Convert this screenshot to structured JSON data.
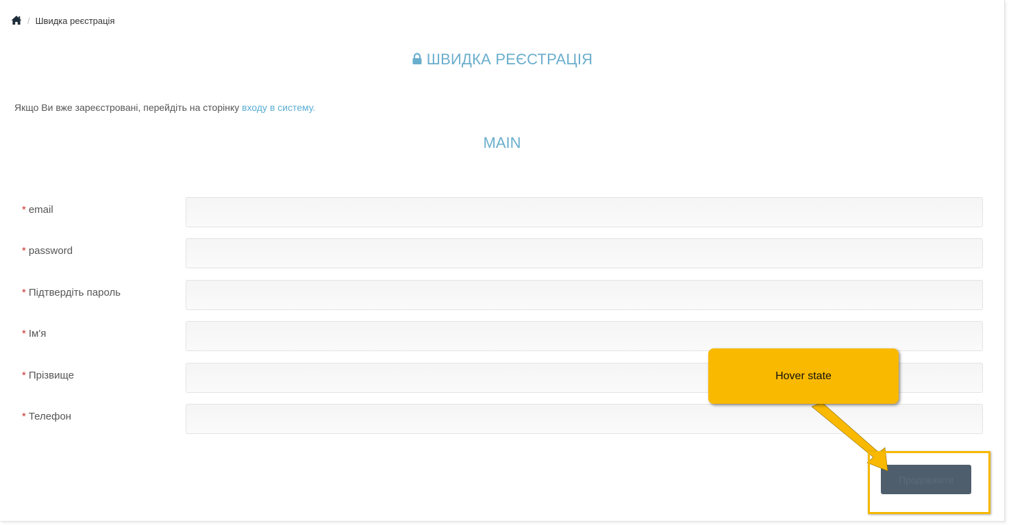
{
  "breadcrumb": {
    "home_icon": "home-icon",
    "current": "Швидка реєстрація"
  },
  "page": {
    "title": "ШВИДКА РЕЄСТРАЦІЯ",
    "title_icon": "lock-icon",
    "info_text": "Якщо Ви вже зареєстровані, перейдіть на сторінку ",
    "login_link": "входу в систему.",
    "section_title": "MAIN"
  },
  "form": {
    "required_mark": "*",
    "fields": [
      {
        "label": "email",
        "value": "",
        "placeholder": ""
      },
      {
        "label": "password",
        "value": "",
        "placeholder": ""
      },
      {
        "label": "Підтвердіть пароль",
        "value": "",
        "placeholder": ""
      },
      {
        "label": "Ім'я",
        "value": "",
        "placeholder": ""
      },
      {
        "label": "Прізвище",
        "value": "",
        "placeholder": ""
      },
      {
        "label": "Телефон",
        "value": "",
        "placeholder": ""
      }
    ],
    "submit_label": "Продовжити"
  },
  "annotation": {
    "callout_text": "Hover state"
  },
  "colors": {
    "accent": "#6aaecd",
    "link": "#5aaed3",
    "required": "#c9302c",
    "button": "#4f5e6d",
    "callout": "#f9b900"
  }
}
